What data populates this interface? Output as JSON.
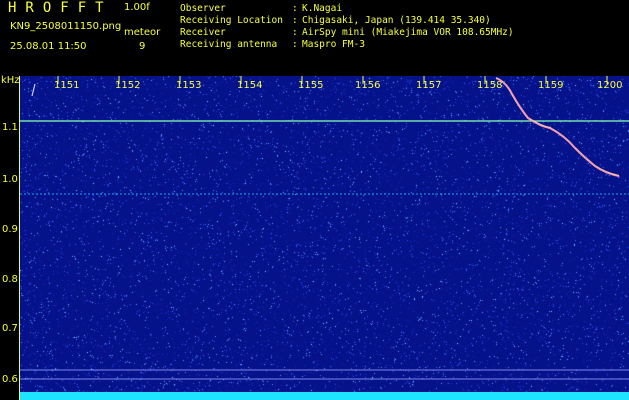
{
  "app": {
    "title": "HROFFT",
    "version": "1.00f"
  },
  "file": {
    "name": "KN9_2508011150.png",
    "timestamp": "25.08.01 11:50"
  },
  "meteor": {
    "label": "meteor",
    "count": "9"
  },
  "info": [
    {
      "key": "Observer",
      "value": "K.Nagai"
    },
    {
      "key": "Receiving Location",
      "value": "Chigasaki, Japan (139.414 35.340)"
    },
    {
      "key": "Receiver",
      "value": "AirSpy mini (Miakejima VOR 108.65MHz)"
    },
    {
      "key": "Receiving antenna",
      "value": "Maspro FM-3"
    }
  ],
  "axis": {
    "y_unit": "kHz",
    "y_ticks": [
      "1.1",
      "1.0",
      "0.9",
      "0.8",
      "0.7",
      "0.6"
    ],
    "x_ticks": [
      "1151",
      "1152",
      "1153",
      "1154",
      "1155",
      "1156",
      "1157",
      "1158",
      "1159",
      "1200"
    ]
  },
  "colors": {
    "label": "#f7ff3c",
    "background": "#06128a",
    "signal": "#1ee4ff"
  }
}
